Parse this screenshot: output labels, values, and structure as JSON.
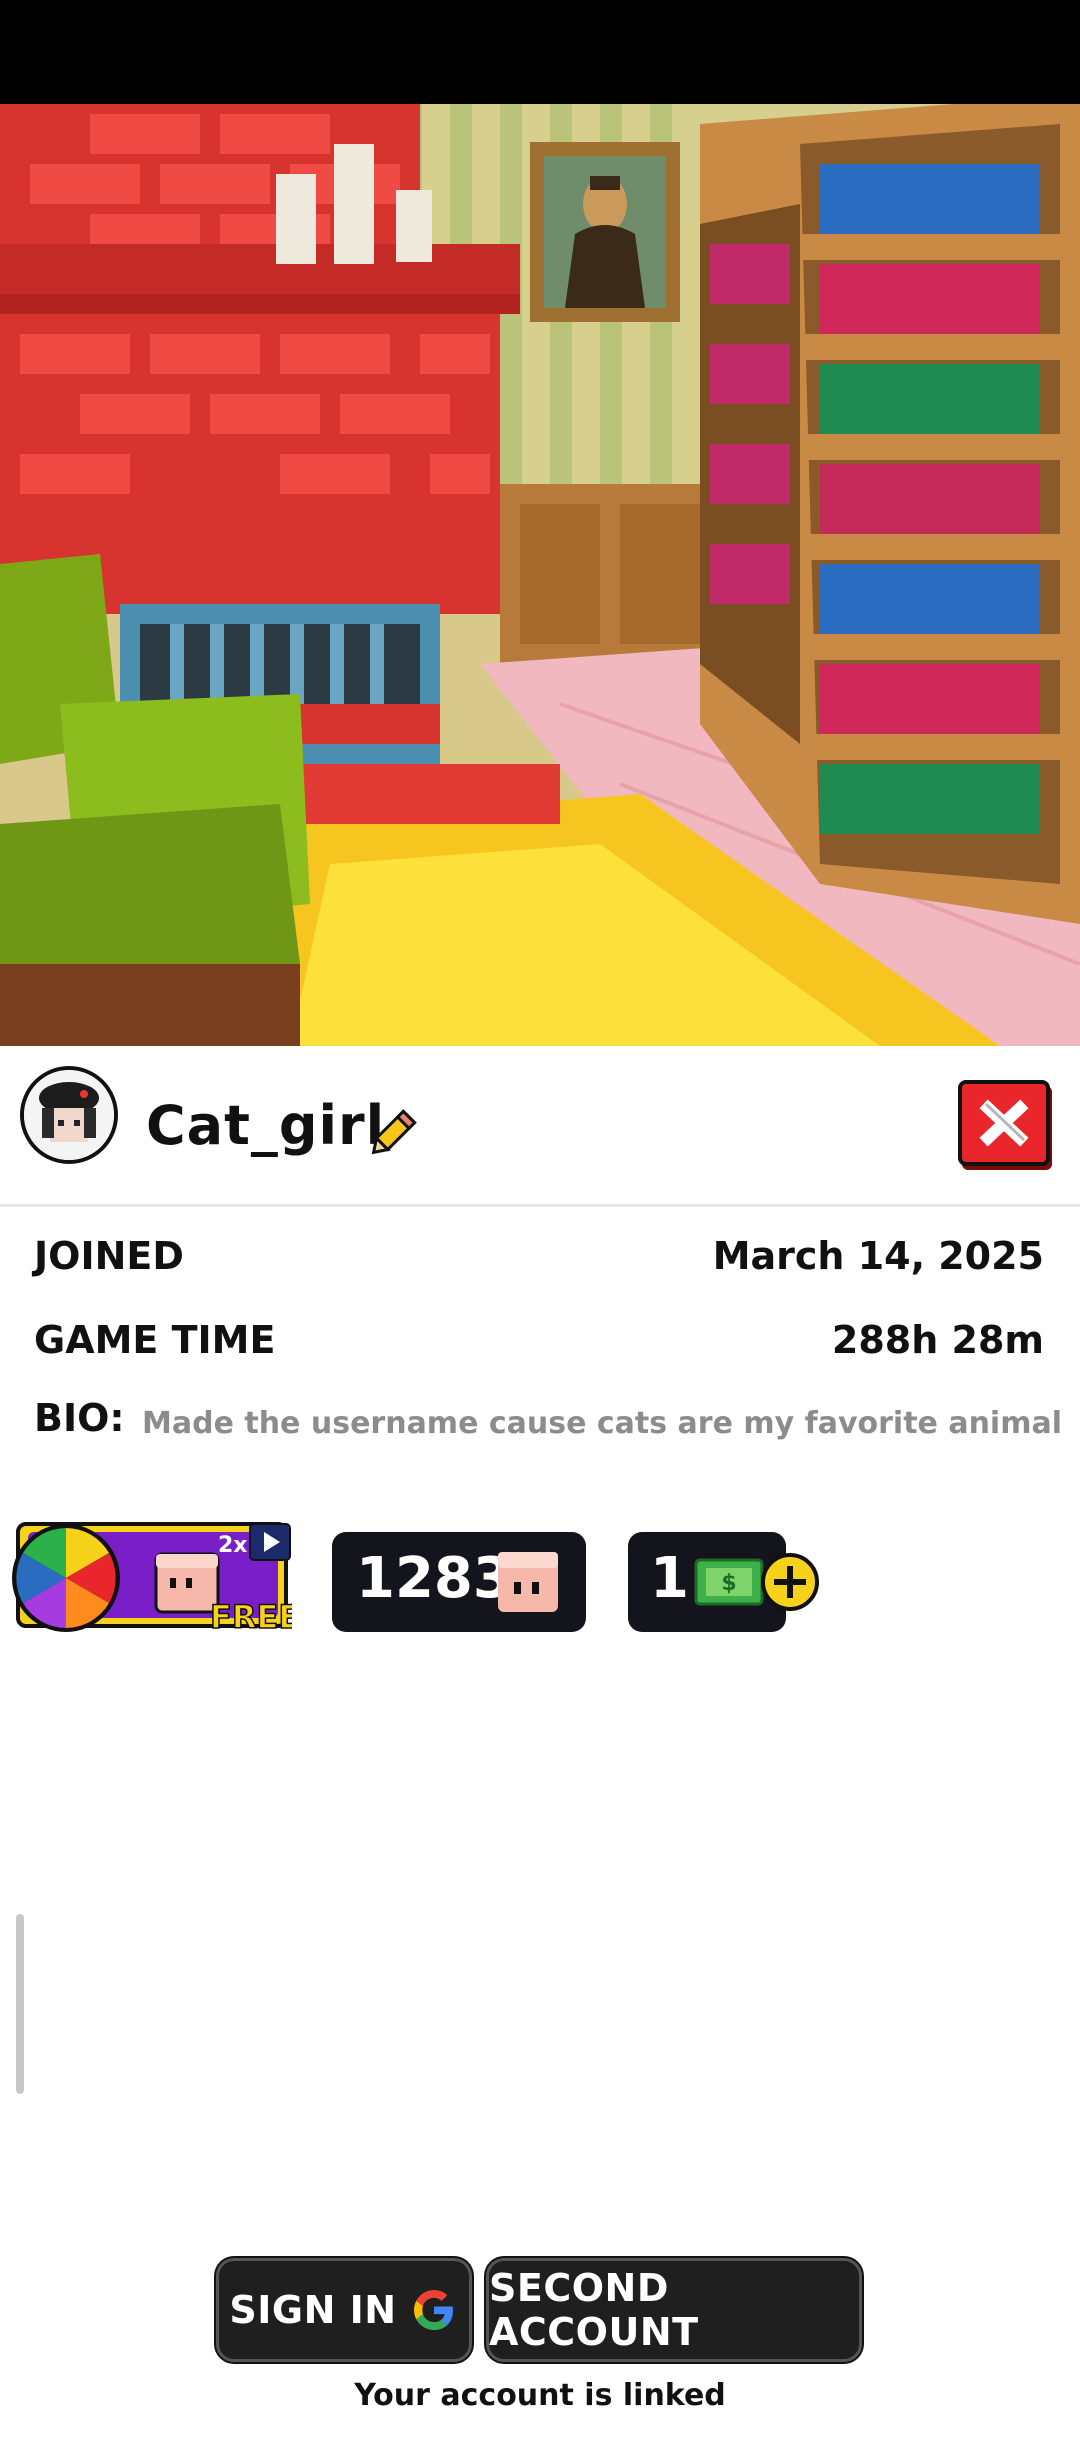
{
  "profile": {
    "username": "Cat_girl",
    "joined_label": "JOINED",
    "joined_value": "March 14, 2025",
    "game_time_label": "GAME TIME",
    "game_time_value": "288h 28m",
    "bio_label": "BIO:",
    "bio_text": "Made the username cause cats are my favorite animal"
  },
  "currency": {
    "spin_multiplier": "2x",
    "spin_free_label": "FREE",
    "coins": "1283",
    "cash": "1"
  },
  "actions": {
    "sign_in_label": "SIGN IN",
    "second_account_label": "SECOND ACCOUNT",
    "linked_status": "Your account is linked"
  },
  "icons": [
    "pencil-icon",
    "close-icon",
    "spin-wheel-icon",
    "video-ad-icon",
    "pig-coin-icon",
    "cash-icon",
    "plus-icon",
    "google-icon"
  ],
  "colors": {
    "accent_red": "#e8262b",
    "accent_yellow": "#f7d21a",
    "pill_dark": "#14141c"
  }
}
